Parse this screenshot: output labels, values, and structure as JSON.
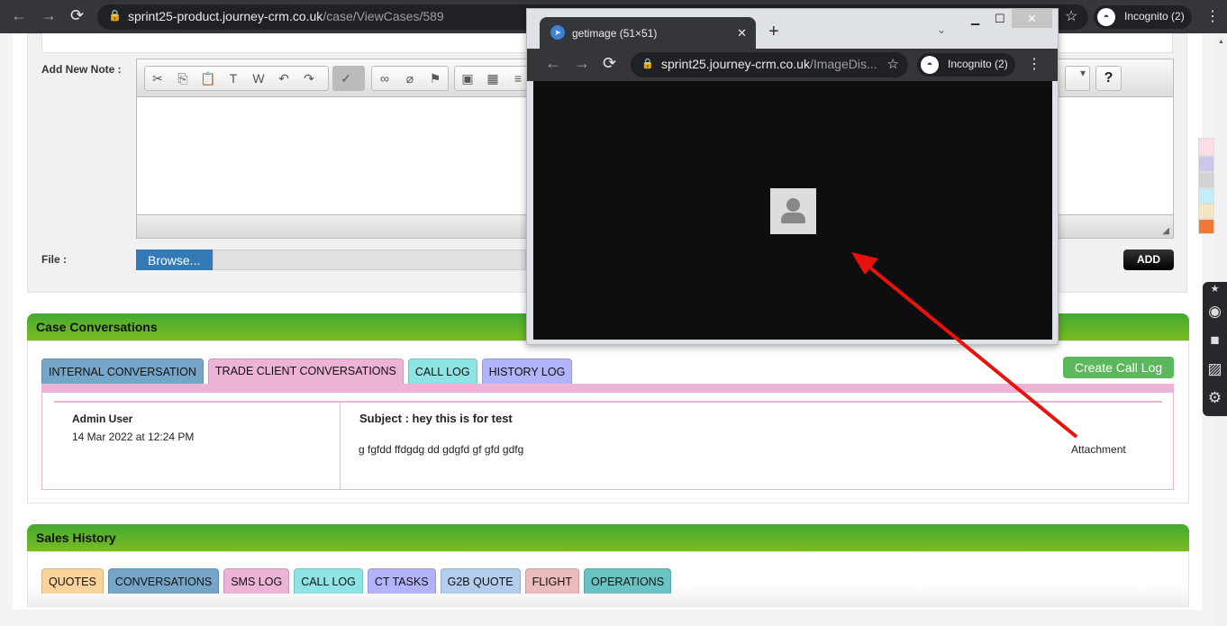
{
  "browser": {
    "url_host": "sprint25-product.journey-crm.co.uk",
    "url_path": "/case/ViewCases/589",
    "profile": "Incognito (2)"
  },
  "note": {
    "label": "Add New Note :",
    "file_label": "File :",
    "browse": "Browse...",
    "add": "ADD",
    "help": "?"
  },
  "case_conversations": {
    "title": "Case Conversations",
    "tabs": [
      {
        "label": "INTERNAL CONVERSATION",
        "color": "#75a6c8"
      },
      {
        "label": "TRADE CLIENT CONVERSATIONS",
        "color": "#edb3d6"
      },
      {
        "label": "CALL LOG",
        "color": "#8ee4e4"
      },
      {
        "label": "HISTORY LOG",
        "color": "#b3b3fb"
      }
    ],
    "create_call_log": "Create Call Log",
    "message": {
      "author": "Admin User",
      "date": "14 Mar 2022 at 12:24 PM",
      "subject": "Subject : hey this is for test",
      "body": "g fgfdd ffdgdg dd gdgfd gf gfd gdfg",
      "attachment": "Attachment"
    }
  },
  "sales_history": {
    "title": "Sales History",
    "tabs": [
      {
        "label": "QUOTES",
        "color": "#fbd39a"
      },
      {
        "label": "CONVERSATIONS",
        "color": "#75a6c8"
      },
      {
        "label": "SMS LOG",
        "color": "#edb3d6"
      },
      {
        "label": "CALL LOG",
        "color": "#8ee4e4"
      },
      {
        "label": "CT TASKS",
        "color": "#b3b3fb"
      },
      {
        "label": "G2B QUOTE",
        "color": "#b3cdee"
      },
      {
        "label": "FLIGHT",
        "color": "#ebbbbb"
      },
      {
        "label": "OPERATIONS",
        "color": "#6ac3c3"
      }
    ]
  },
  "popup": {
    "tab_title": "getimage (51×51)",
    "url_host": "sprint25.journey-crm.co.uk",
    "url_path": "/ImageDis...",
    "profile": "Incognito (2)"
  },
  "swatches": [
    "#fbdde8",
    "#cdc6e8",
    "#d3d3d3",
    "#c3eef9",
    "#f3e6c0",
    "#f07a35"
  ]
}
